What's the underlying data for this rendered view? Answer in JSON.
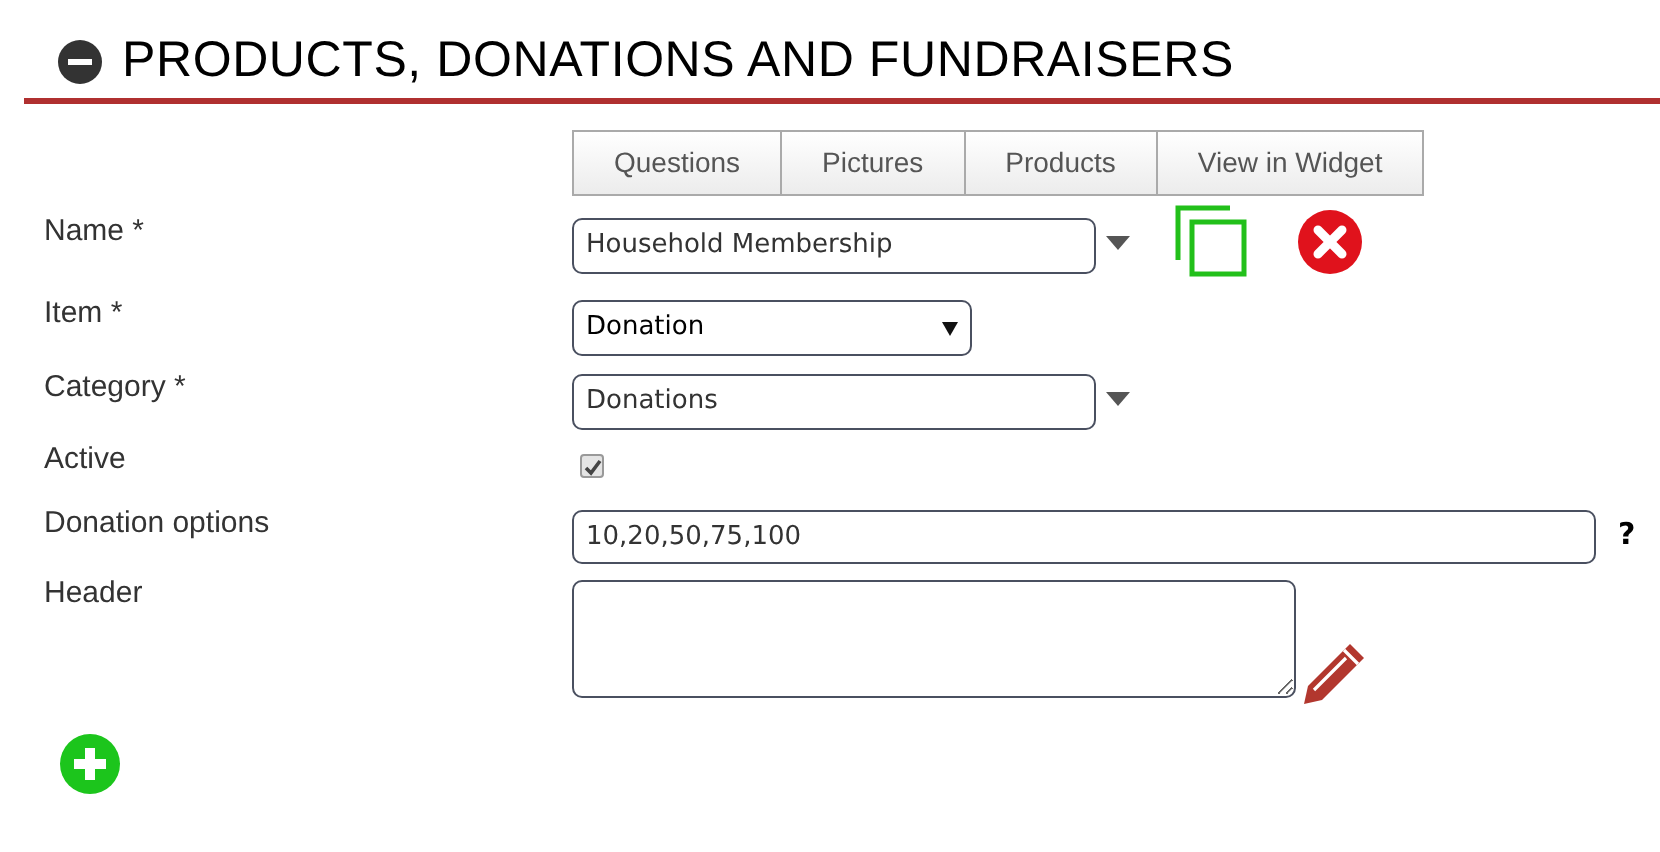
{
  "title": "PRODUCTS, DONATIONS AND FUNDRAISERS",
  "expanded": true,
  "tabs": [
    "Questions",
    "Pictures",
    "Products",
    "View in Widget"
  ],
  "fields": [
    {
      "kind": "combo",
      "label": "Name *",
      "value": "Household Membership",
      "actions": true
    },
    {
      "kind": "select",
      "label": "Item *",
      "value": "Donation"
    },
    {
      "kind": "combo",
      "label": "Category *",
      "value": "Donations",
      "actions": false
    },
    {
      "kind": "checkbox",
      "label": "Active",
      "checked": true
    },
    {
      "kind": "text",
      "label": "Donation options",
      "value": "10,20,50,75,100",
      "help": "?"
    },
    {
      "kind": "textarea",
      "label": "Header"
    }
  ]
}
